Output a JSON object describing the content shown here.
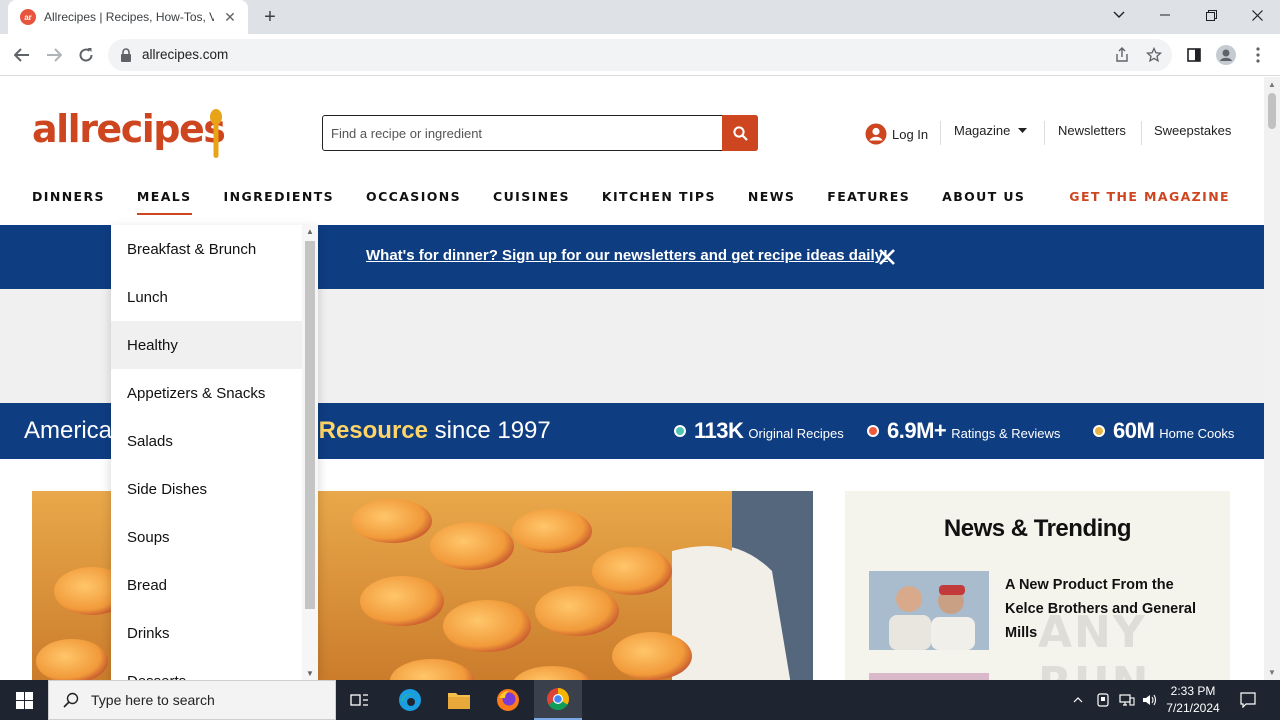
{
  "browser": {
    "tab_title": "Allrecipes | Recipes, How-Tos, Videos and More",
    "favicon_text": "ar",
    "url": "allrecipes.com"
  },
  "header": {
    "logo_text": "allrecipes",
    "search_placeholder": "Find a recipe or ingredient",
    "login_label": "Log In",
    "magazine_label": "Magazine",
    "newsletters_label": "Newsletters",
    "sweepstakes_label": "Sweepstakes"
  },
  "nav": {
    "items": [
      "DINNERS",
      "MEALS",
      "INGREDIENTS",
      "OCCASIONS",
      "CUISINES",
      "KITCHEN TIPS",
      "NEWS",
      "FEATURES",
      "ABOUT US"
    ],
    "active": "MEALS",
    "get_magazine": "GET THE MAGAZINE"
  },
  "meals_dropdown": {
    "items": [
      "Breakfast & Brunch",
      "Lunch",
      "Healthy",
      "Appetizers & Snacks",
      "Salads",
      "Side Dishes",
      "Soups",
      "Bread",
      "Drinks",
      "Desserts"
    ],
    "hovered": "Healthy"
  },
  "promo": {
    "text": "What's for dinner? Sign up for our newsletters and get recipe ideas daily!"
  },
  "stats": {
    "headline_start": "America'",
    "headline_highlight": "Resource",
    "headline_end": " since 1997",
    "items": [
      {
        "value": "113K",
        "label": "Original Recipes",
        "color": "#4fc3b5"
      },
      {
        "value": "6.9M+",
        "label": "Ratings & Reviews",
        "color": "#ef5a3c"
      },
      {
        "value": "60M",
        "label": "Home Cooks",
        "color": "#e8b443"
      }
    ]
  },
  "news": {
    "title": "News & Trending",
    "article_title": "A New Product From the Kelce Brothers and General Mills"
  },
  "watermark": "ANY RUN",
  "taskbar": {
    "search_placeholder": "Type here to search",
    "time": "2:33 PM",
    "date": "7/21/2024"
  },
  "colors": {
    "brand": "#ce4620",
    "navy": "#0f3d82",
    "highlight": "#ffd567"
  }
}
